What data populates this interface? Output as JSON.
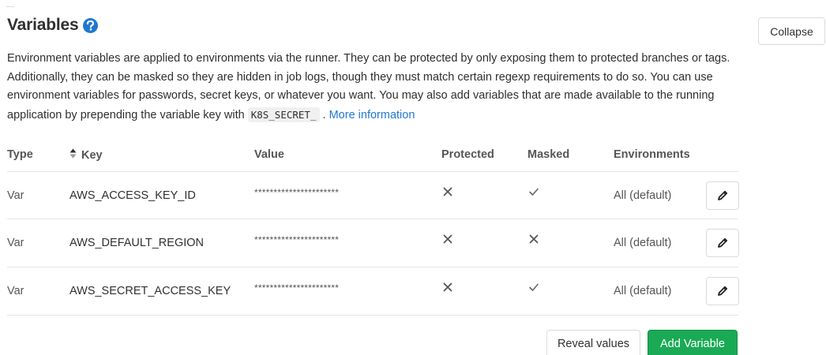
{
  "section": {
    "title": "Variables",
    "collapse_label": "Collapse",
    "description": {
      "text_before": "Environment variables are applied to environments via the runner. They can be protected by only exposing them to protected branches or tags. Additionally, they can be masked so they are hidden in job logs, though they must match certain regexp requirements to do so. You can use environment variables for passwords, secret keys, or whatever you want. You may also add variables that are made available to the running application by prepending the variable key with ",
      "code": "K8S_SECRET_",
      "text_after": ".",
      "link_text": "More information"
    }
  },
  "table": {
    "headers": {
      "type": "Type",
      "key": "Key",
      "value": "Value",
      "protected": "Protected",
      "masked": "Masked",
      "environments": "Environments"
    },
    "rows": [
      {
        "type": "Var",
        "key": "AWS_ACCESS_KEY_ID",
        "value": "**********************",
        "protected": false,
        "masked": true,
        "environment": "All (default)"
      },
      {
        "type": "Var",
        "key": "AWS_DEFAULT_REGION",
        "value": "**********************",
        "protected": false,
        "masked": false,
        "environment": "All (default)"
      },
      {
        "type": "Var",
        "key": "AWS_SECRET_ACCESS_KEY",
        "value": "**********************",
        "protected": false,
        "masked": true,
        "environment": "All (default)"
      }
    ]
  },
  "actions": {
    "reveal_label": "Reveal values",
    "add_label": "Add Variable"
  },
  "colors": {
    "link": "#1f78d1",
    "primary_button": "#1aaa55",
    "help_icon": "#1f78d1"
  },
  "icons": {
    "help": "question-circle-icon",
    "sort": "sort-icon",
    "edit": "pencil-icon",
    "true_mark": "check-icon",
    "false_mark": "close-icon"
  }
}
